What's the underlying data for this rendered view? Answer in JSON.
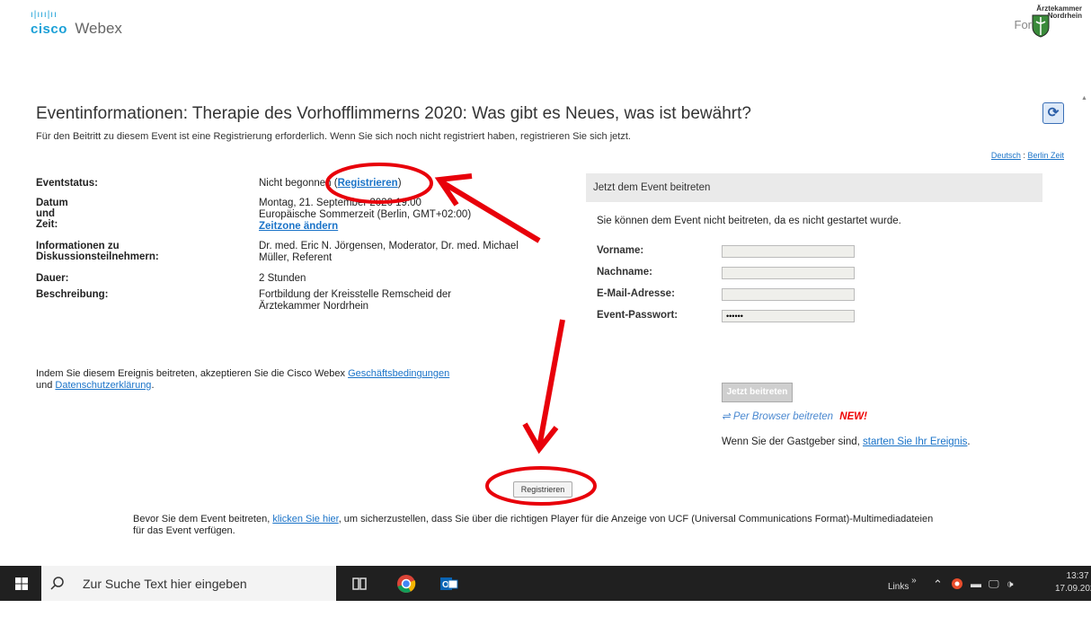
{
  "header": {
    "brand_cisco": "cisco",
    "brand_webex": "Webex",
    "for_label": "For",
    "org_name_line1": "Ärztekammer",
    "org_name_line2": "Nordrhein"
  },
  "page": {
    "title": "Eventinformationen: Therapie des Vorhofflimmerns 2020: Was gibt es Neues, was ist bewährt?",
    "intro": "Für den Beitritt zu diesem Event ist eine Registrierung erforderlich. Wenn Sie sich noch nicht registriert haben, registrieren Sie sich jetzt.",
    "lang_link_1": "Deutsch",
    "lang_sep": ":",
    "lang_link_2": "Berlin Zeit"
  },
  "info": {
    "status_label": "Eventstatus:",
    "status_value": "Nicht begonnen (",
    "status_link": "Registrieren",
    "status_close": ")",
    "date_label": "Datum und Zeit:",
    "date_line1": "Montag, 21. September 2020 19:00",
    "date_line2": "Europäische Sommerzeit (Berlin, GMT+02:00)",
    "date_link": "Zeitzone ändern",
    "panel_label": "Informationen zu Diskussionsteilnehmern:",
    "panel_value": "Dr. med. Eric N. Jörgensen, Moderator, Dr. med. Michael Müller, Referent",
    "duration_label": "Dauer:",
    "duration_value": "2 Stunden",
    "desc_label": "Beschreibung:",
    "desc_value": "Fortbildung der Kreisstelle Remscheid der Ärztekammer Nordrhein"
  },
  "accept": {
    "text1": "Indem Sie diesem Ereignis beitreten, akzeptieren Sie die Cisco Webex ",
    "link1": "Geschäftsbedingungen",
    "text2": "und ",
    "link2": "Datenschutzerklärung",
    "text3": "."
  },
  "join": {
    "title": "Jetzt dem Event beitreten",
    "message": "Sie können dem Event nicht beitreten, da es nicht gestartet wurde.",
    "firstname_label": "Vorname:",
    "firstname_value": "",
    "lastname_label": "Nachname:",
    "lastname_value": "",
    "email_label": "E-Mail-Adresse:",
    "email_value": "",
    "password_label": "Event-Passwort:",
    "password_value": "••••••",
    "join_button": "Jetzt beitreten",
    "browser_join": "Per Browser beitreten",
    "browser_new": "NEW!",
    "host_text": "Wenn Sie der Gastgeber sind, ",
    "host_link": "starten Sie Ihr Ereignis",
    "host_end": "."
  },
  "register_button": "Registrieren",
  "before_join": {
    "text1": "Bevor Sie dem Event beitreten, ",
    "link": "klicken Sie hier",
    "text2": ", um sicherzustellen, dass Sie über die richtigen Player für die Anzeige von UCF (Universal Communications Format)-Multimediadateien für das Event verfügen."
  },
  "taskbar": {
    "search_placeholder": "Zur Suche Text hier eingeben",
    "links_label": "Links",
    "time": "13:37",
    "date": "17.09.2020"
  },
  "colors": {
    "accent": "#1a73c8",
    "annotation_red": "#e8000a",
    "taskbar": "#202020"
  }
}
